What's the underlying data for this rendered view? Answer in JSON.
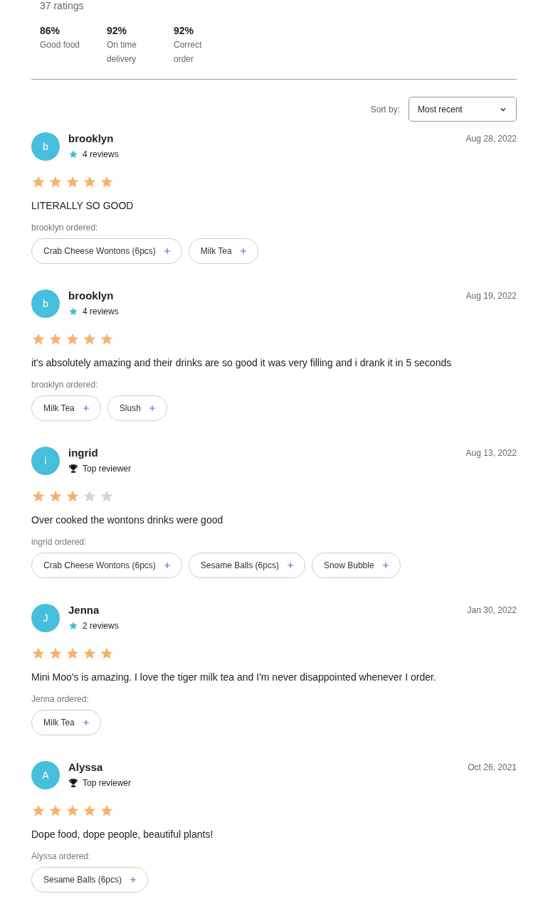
{
  "summary": {
    "ratings_count": "37 ratings",
    "stats": [
      {
        "value": "86%",
        "label": "Good food"
      },
      {
        "value": "92%",
        "label": "On time delivery"
      },
      {
        "value": "92%",
        "label": "Correct order"
      }
    ]
  },
  "sort": {
    "label": "Sort by:",
    "value": "Most recent"
  },
  "reviews": [
    {
      "initial": "b",
      "name": "brooklyn",
      "badge": {
        "kind": "star",
        "text": "4 reviews"
      },
      "date": "Aug 28, 2022",
      "stars": 5,
      "text": "LITERALLY SO GOOD",
      "ordered_label": "brooklyn ordered:",
      "items": [
        "Crab Cheese Wontons (6pcs)",
        "Milk Tea"
      ]
    },
    {
      "initial": "b",
      "name": "brooklyn",
      "badge": {
        "kind": "star",
        "text": "4 reviews"
      },
      "date": "Aug 19, 2022",
      "stars": 5,
      "text": "it's absolutely amazing and their drinks are so good it was very filling and i drank it in 5 seconds",
      "ordered_label": "brooklyn ordered:",
      "items": [
        "Milk Tea",
        "Slush"
      ]
    },
    {
      "initial": "i",
      "name": "ingrid",
      "badge": {
        "kind": "trophy",
        "text": "Top reviewer"
      },
      "date": "Aug 13, 2022",
      "stars": 3,
      "text": "Over cooked the wontons drinks were good",
      "ordered_label": "ingrid ordered:",
      "items": [
        "Crab Cheese Wontons (6pcs)",
        "Sesame Balls (6pcs)",
        "Snow Bubble"
      ]
    },
    {
      "initial": "J",
      "name": "Jenna",
      "badge": {
        "kind": "star",
        "text": "2 reviews"
      },
      "date": "Jan 30, 2022",
      "stars": 5,
      "text": "Mini Moo's is amazing. I love the tiger milk tea and I'm never disappointed whenever I order.",
      "ordered_label": "Jenna ordered:",
      "items": [
        "Milk Tea"
      ]
    },
    {
      "initial": "A",
      "name": "Alyssa",
      "badge": {
        "kind": "trophy",
        "text": "Top reviewer"
      },
      "date": "Oct 26, 2021",
      "stars": 5,
      "text": "Dope food, dope people, beautiful plants!",
      "ordered_label": "Alyssa ordered:",
      "items": [
        "Sesame Balls (6pcs)"
      ]
    }
  ]
}
